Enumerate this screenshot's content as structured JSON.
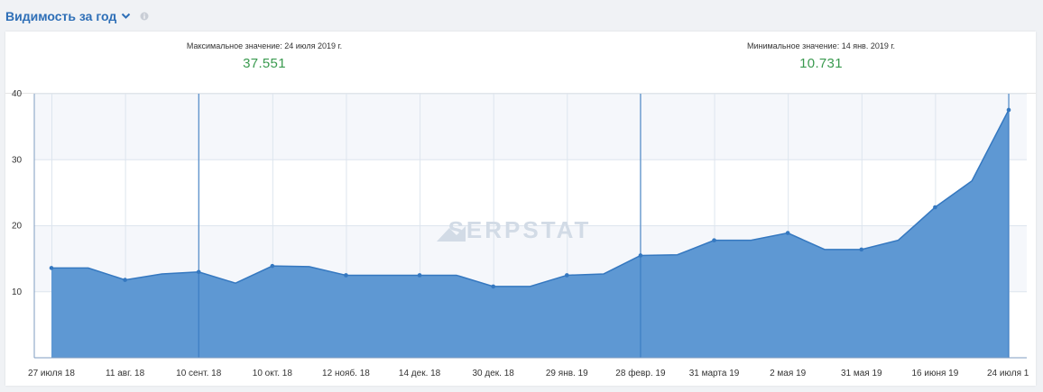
{
  "widget": {
    "title": "Видимость за год",
    "dropdown_icon": "chevron-down-icon",
    "info_icon": "info-icon"
  },
  "stats": {
    "max_label": "Максимальное значение: 24 июля 2019 г.",
    "max_value": "37.551",
    "min_label": "Минимальное значение: 14 янв. 2019 г.",
    "min_value": "10.731"
  },
  "watermark": "SERPSTAT",
  "colors": {
    "title": "#2e6fb7",
    "area_fill": "#5b96d2",
    "line": "#3578c0",
    "value_green": "#3a9a4f",
    "plot_band": "#f5f7fb",
    "grid": "#dde5ee"
  },
  "chart_data": {
    "type": "area",
    "x_tick_labels": [
      "27 июля 18",
      "11 авг. 18",
      "10 сент. 18",
      "10 окт. 18",
      "12 нояб. 18",
      "14 дек. 18",
      "30 дек. 18",
      "29 янв. 19",
      "28 февр. 19",
      "31 марта 19",
      "2 мая 19",
      "31 мая 19",
      "16 июня 19",
      "24 июля 1"
    ],
    "y_ticks": [
      10,
      20,
      30,
      40
    ],
    "ylim": [
      0,
      40
    ],
    "series": [
      {
        "values": [
          13.6,
          13.6,
          11.8,
          12.7,
          13.0,
          11.3,
          13.9,
          13.8,
          12.5,
          12.5,
          12.5,
          12.5,
          10.8,
          10.8,
          12.5,
          12.7,
          15.5,
          15.6,
          17.8,
          17.8,
          18.9,
          16.4,
          16.4,
          17.8,
          22.8,
          26.8,
          37.551
        ],
        "markers": [
          0,
          2,
          4,
          6,
          8,
          10,
          12,
          14,
          16,
          18,
          20,
          22,
          24,
          26
        ]
      }
    ],
    "vertical_lines_at_points": [
      4,
      16,
      26
    ],
    "grid": true,
    "legend": "none"
  }
}
